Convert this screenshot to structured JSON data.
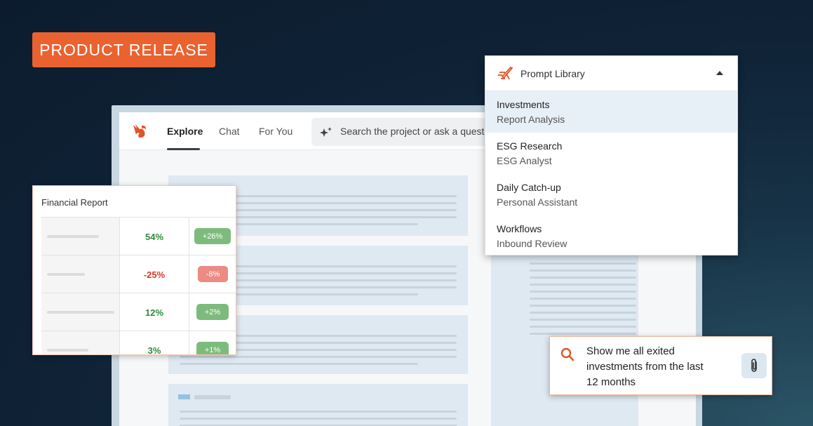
{
  "badge": {
    "label": "PRODUCT RELEASE"
  },
  "app": {
    "tabs": [
      {
        "label": "Explore",
        "active": true
      },
      {
        "label": "Chat",
        "active": false
      },
      {
        "label": "For You",
        "active": false
      }
    ],
    "search_placeholder": "Search the project or ask a question"
  },
  "financial_report": {
    "title": "Financial Report",
    "rows": [
      {
        "value": "54%",
        "change": "+26%",
        "trend": "up"
      },
      {
        "value": "-25%",
        "change": "-8%",
        "trend": "down"
      },
      {
        "value": "12%",
        "change": "+2%",
        "trend": "up"
      },
      {
        "value": "3%",
        "change": "+1%",
        "trend": "up"
      }
    ]
  },
  "prompt_library": {
    "title": "Prompt Library",
    "items": [
      {
        "title": "Investments",
        "subtitle": "Report Analysis",
        "selected": true
      },
      {
        "title": "ESG Research",
        "subtitle": "ESG Analyst",
        "selected": false
      },
      {
        "title": "Daily Catch-up",
        "subtitle": "Personal Assistant",
        "selected": false
      },
      {
        "title": "Workflows",
        "subtitle": "Inbound Review",
        "selected": false
      }
    ]
  },
  "query": {
    "lines": [
      "Show me all exited",
      "investments from the last",
      "12 months"
    ]
  },
  "colors": {
    "accent": "#ea6230",
    "positive": "#2e8b3a",
    "negative": "#d23a2a"
  }
}
